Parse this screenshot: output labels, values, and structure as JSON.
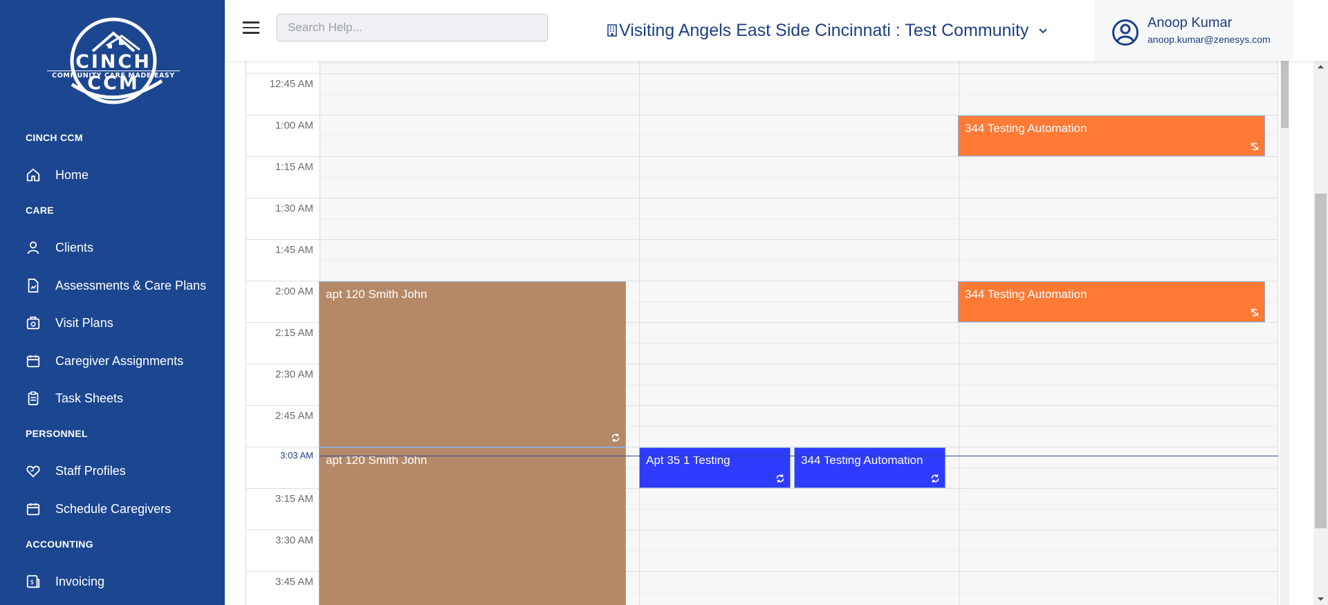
{
  "app": {
    "logo_title": "CINCH CCM",
    "logo_tagline": "COMMUNITY CARE MADE EASY",
    "brand_color": "#1c4690"
  },
  "sidebar": {
    "sections": [
      {
        "label": "CINCH CCM"
      },
      {
        "label": "CARE"
      },
      {
        "label": "PERSONNEL"
      },
      {
        "label": "ACCOUNTING"
      }
    ],
    "items": [
      {
        "label": "Home",
        "icon": "home-icon"
      },
      {
        "label": "Clients",
        "icon": "user-icon"
      },
      {
        "label": "Assessments & Care Plans",
        "icon": "document-chart-icon"
      },
      {
        "label": "Visit Plans",
        "icon": "visit-plan-icon"
      },
      {
        "label": "Caregiver Assignments",
        "icon": "calendar-icon"
      },
      {
        "label": "Task Sheets",
        "icon": "clipboard-icon"
      },
      {
        "label": "Staff Profiles",
        "icon": "heart-hand-icon"
      },
      {
        "label": "Schedule Caregivers",
        "icon": "calendar-icon"
      },
      {
        "label": "Invoicing",
        "icon": "invoice-icon"
      }
    ]
  },
  "header": {
    "search_placeholder": "Search Help...",
    "community": "Visiting Angels East Side Cincinnati : Test Community",
    "user_name": "Anoop Kumar",
    "user_email": "anoop.kumar@zenesys.com"
  },
  "calendar": {
    "time_labels": [
      "12:45 AM",
      "1:00 AM",
      "1:15 AM",
      "1:30 AM",
      "1:45 AM",
      "2:00 AM",
      "2:15 AM",
      "2:30 AM",
      "2:45 AM",
      "3:03 AM",
      "3:15 AM",
      "3:30 AM",
      "3:45 AM"
    ],
    "current_time": "3:03 AM",
    "events": [
      {
        "title": "344 Testing Automation",
        "color": "#ff7a35",
        "icon": "no-sync-icon"
      },
      {
        "title": "344 Testing Automation",
        "color": "#ff7a35",
        "icon": "no-sync-icon"
      },
      {
        "title": "apt 120 Smith John",
        "color": "#b58967",
        "icon": "sync-icon"
      },
      {
        "title": "apt 120 Smith John",
        "color": "#b58967",
        "icon": ""
      },
      {
        "title": "Apt 35 1 Testing",
        "color": "#2f3bff",
        "icon": "sync-icon"
      },
      {
        "title": "344 Testing Automation",
        "color": "#2f3bff",
        "icon": "sync-icon"
      }
    ]
  }
}
